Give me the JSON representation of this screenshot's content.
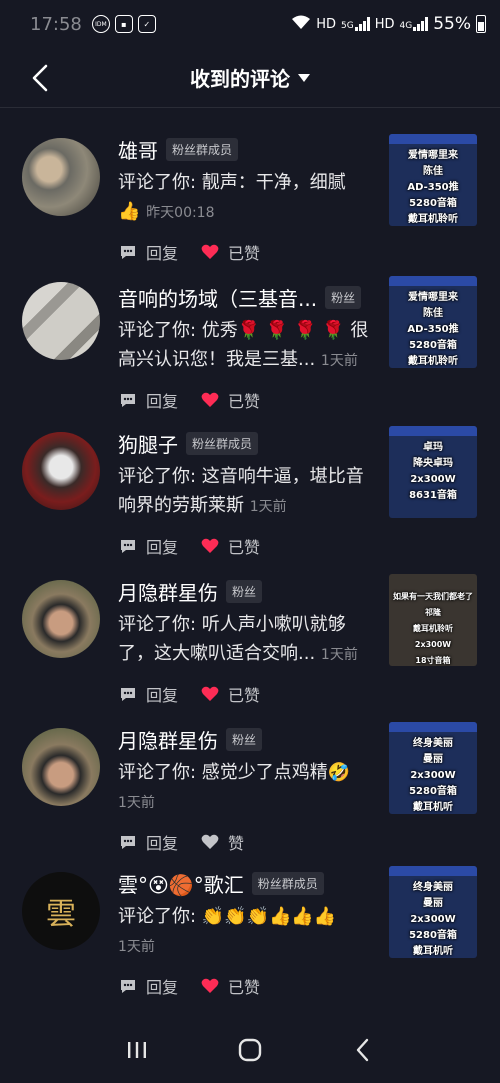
{
  "status_bar": {
    "time": "17:58",
    "left_icons": [
      "IDM",
      "photo-icon",
      "check-icon"
    ],
    "network_labels": [
      "HD",
      "5G",
      "HD",
      "4G"
    ],
    "battery_percent": "55%"
  },
  "header": {
    "title": "收到的评论"
  },
  "comments": [
    {
      "name": "雄哥",
      "badge": "粉丝群成员",
      "text": "评论了你: 靓声：干净，细腻",
      "emoji": "👍",
      "time": "昨天00:18",
      "reply_label": "回复",
      "like_label": "已赞",
      "liked": true,
      "thumb_lines": [
        "爱情哪里来",
        "陈佳",
        "AD-350推",
        "5280音箱",
        "戴耳机聆听"
      ]
    },
    {
      "name": "音响的场域（三基音...",
      "badge": "粉丝",
      "text": "评论了你: 优秀🌹 🌹 🌹 🌹 很高兴认识您！我是三基...",
      "time": "1天前",
      "reply_label": "回复",
      "like_label": "已赞",
      "liked": true,
      "thumb_lines": [
        "爱情哪里来",
        "陈佳",
        "AD-350推",
        "5280音箱",
        "戴耳机聆听"
      ]
    },
    {
      "name": "狗腿子",
      "badge": "粉丝群成员",
      "text": "评论了你: 这音响牛逼，堪比音响界的劳斯莱斯",
      "time": "1天前",
      "reply_label": "回复",
      "like_label": "已赞",
      "liked": true,
      "thumb_lines": [
        "卓玛",
        "降央卓玛",
        "2x300W",
        "8631音箱"
      ]
    },
    {
      "name": "月隐群星伤",
      "badge": "粉丝",
      "text": "评论了你: 听人声小嗽叭就够了，这大嗽叭适合交响...",
      "time": "1天前",
      "reply_label": "回复",
      "like_label": "已赞",
      "liked": true,
      "thumb_lines": [
        "如果有一天我们都老了",
        "祁隆",
        "戴耳机聆听",
        "2x300W",
        "18寸音箱"
      ]
    },
    {
      "name": "月隐群星伤",
      "badge": "粉丝",
      "text": "评论了你: 感觉少了点鸡精🤣",
      "time": "1天前",
      "reply_label": "回复",
      "like_label": "赞",
      "liked": false,
      "thumb_lines": [
        "终身美丽",
        "曼丽",
        "2x300W",
        "5280音箱",
        "戴耳机听"
      ]
    },
    {
      "name": "雲°😵🏀°歌汇",
      "badge": "粉丝群成员",
      "text": "评论了你: 👏👏👏👍👍👍",
      "time": "1天前",
      "reply_label": "回复",
      "like_label": "已赞",
      "liked": true,
      "thumb_lines": [
        "终身美丽",
        "曼丽",
        "2x300W",
        "5280音箱",
        "戴耳机听"
      ]
    }
  ],
  "colors": {
    "background": "#161823",
    "liked_heart": "#fe2c55",
    "unliked_heart": "#c3c4c8"
  }
}
